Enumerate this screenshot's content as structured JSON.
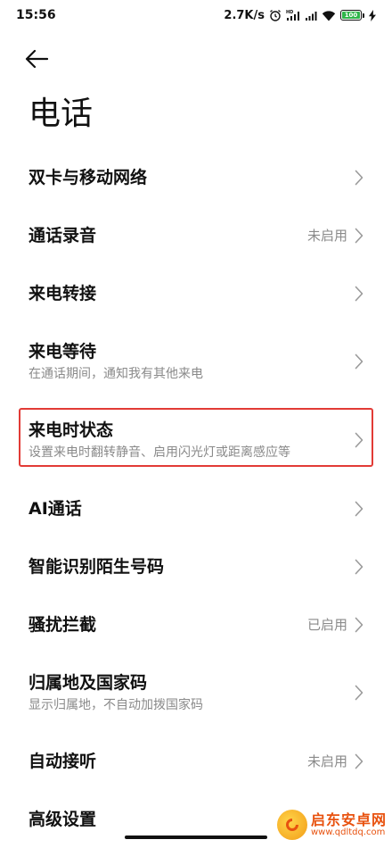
{
  "status_bar": {
    "time": "15:56",
    "net_speed": "2.7K/s",
    "battery_level": "100",
    "battery_color": "#2fb54a"
  },
  "header": {
    "title": "电话"
  },
  "settings": {
    "items": [
      {
        "title": "双卡与移动网络",
        "subtitle": "",
        "value": ""
      },
      {
        "title": "通话录音",
        "subtitle": "",
        "value": "未启用"
      },
      {
        "title": "来电转接",
        "subtitle": "",
        "value": ""
      },
      {
        "title": "来电等待",
        "subtitle": "在通话期间，通知我有其他来电",
        "value": ""
      },
      {
        "title": "来电时状态",
        "subtitle": "设置来电时翻转静音、启用闪光灯或距离感应等",
        "value": ""
      },
      {
        "title": "AI通话",
        "subtitle": "",
        "value": ""
      },
      {
        "title": "智能识别陌生号码",
        "subtitle": "",
        "value": ""
      },
      {
        "title": "骚扰拦截",
        "subtitle": "",
        "value": "已启用"
      },
      {
        "title": "归属地及国家码",
        "subtitle": "显示归属地，不自动加拨国家码",
        "value": ""
      },
      {
        "title": "自动接听",
        "subtitle": "",
        "value": "未启用"
      },
      {
        "title": "高级设置",
        "subtitle": "",
        "value": ""
      }
    ]
  },
  "highlight_color": "#e23b36",
  "watermark": {
    "name": "启东安卓网",
    "url": "www.qdltdq.com"
  }
}
